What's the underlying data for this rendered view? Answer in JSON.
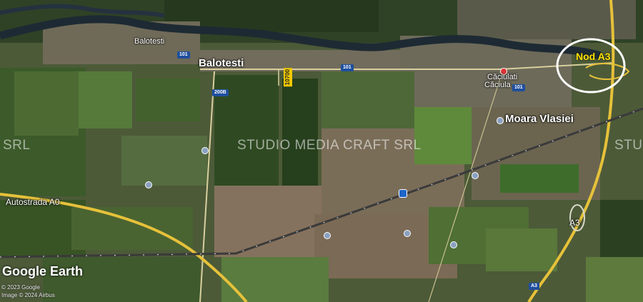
{
  "map": {
    "places": {
      "balotesti_small": "Balotesti",
      "balotesti_large": "Balotesti",
      "caciulati_1": "Căciulati",
      "caciulati_2": "Căciula",
      "moara_vlasiei": "Moara Vlasiei"
    },
    "roads": {
      "r101_a": "101",
      "r101_b": "101",
      "r101_c": "101",
      "r200b": "200B",
      "r10700": "10700",
      "autostrada_a0": "Autostrada A0",
      "a3_label": "A3",
      "a3_shield": "A3"
    },
    "annotation": {
      "nod_a3": "Nod A3"
    },
    "watermarks": {
      "left": "SRL",
      "center": "STUDIO MEDIA CRAFT SRL",
      "right": "STU"
    },
    "attribution": {
      "logo": "Google Earth",
      "line1": "© 2023 Google",
      "line2": "Image © 2024 Airbus"
    },
    "colors": {
      "highway": "#e6c13a",
      "rail": "#3a3a3a",
      "river": "#1e2a33",
      "nod_circle": "#ffffff",
      "nod_text": "#ffe000"
    }
  }
}
